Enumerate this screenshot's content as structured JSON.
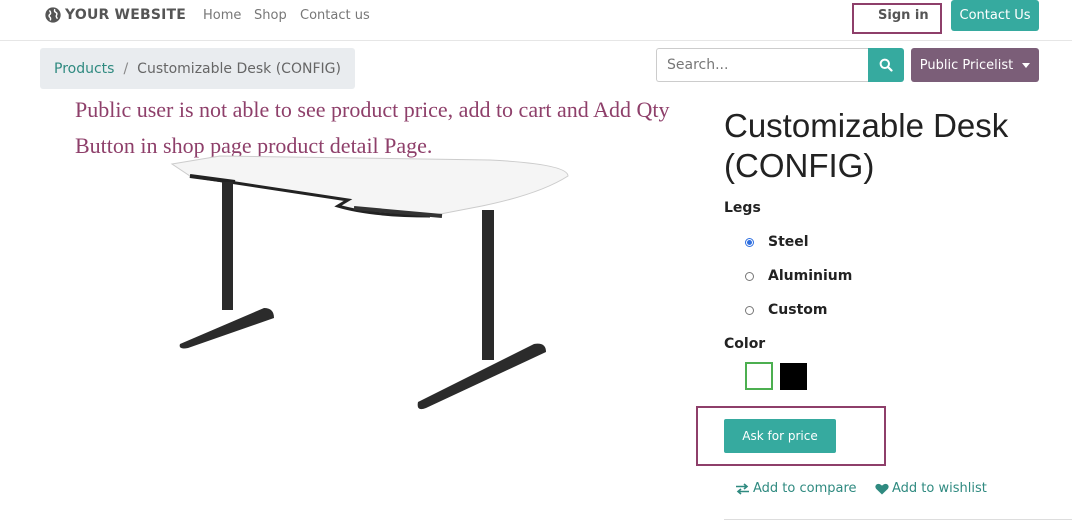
{
  "header": {
    "logo_text": "YOUR WEBSITE",
    "logo_icon": "globe-icon",
    "nav": [
      "Home",
      "Shop",
      "Contact us"
    ],
    "sign_in": "Sign in",
    "contact_button": "Contact Us"
  },
  "breadcrumb": {
    "parent": "Products",
    "separator": "/",
    "current": "Customizable Desk (CONFIG)"
  },
  "search": {
    "placeholder": "Search...",
    "button_icon": "search-icon"
  },
  "pricelist": {
    "label": "Public Pricelist"
  },
  "annotation": "Public user is not able to see product price, add to cart and Add Qty Button in shop page product detail Page.",
  "product": {
    "title": "Customizable Desk (CONFIG)",
    "legs_label": "Legs",
    "legs_options": [
      "Steel",
      "Aluminium",
      "Custom"
    ],
    "legs_selected": "Steel",
    "color_label": "Color",
    "colors": [
      "#ffffff",
      "#000000"
    ],
    "selected_color": "#ffffff",
    "ask_price": "Ask for price",
    "add_to_compare": "Add to compare",
    "add_to_wishlist": "Add to wishlist"
  },
  "colors": {
    "primary": "#36aa9f",
    "pricelist": "#7b5e78",
    "annotation": "#8e3f6a",
    "link": "#2f8a80"
  }
}
